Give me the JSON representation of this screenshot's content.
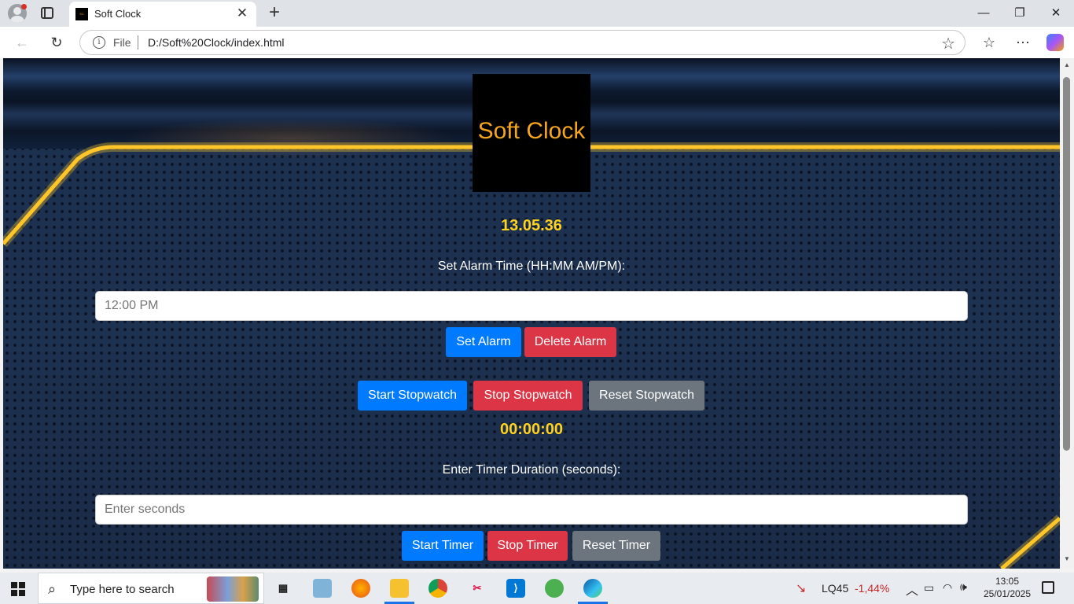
{
  "browser": {
    "tab_title": "Soft Clock",
    "tab_close": "✕",
    "new_tab": "+",
    "address_scheme": "File",
    "address_url": "D:/Soft%20Clock/index.html",
    "window_controls": {
      "minimize": "—",
      "restore": "❐",
      "close": "✕"
    }
  },
  "page": {
    "logo_text": "Soft Clock",
    "clock_time": "13.05.36",
    "alarm_label": "Set Alarm Time (HH:MM AM/PM):",
    "alarm_placeholder": "12:00 PM",
    "set_alarm": "Set Alarm",
    "delete_alarm": "Delete Alarm",
    "start_stopwatch": "Start Stopwatch",
    "stop_stopwatch": "Stop Stopwatch",
    "reset_stopwatch": "Reset Stopwatch",
    "stopwatch_time": "00:00:00",
    "timer_label": "Enter Timer Duration (seconds):",
    "timer_placeholder": "Enter seconds",
    "start_timer": "Start Timer",
    "stop_timer": "Stop Timer",
    "reset_timer": "Reset Timer",
    "colors": {
      "accent_gold": "#ffd21f",
      "logo_orange": "#f5a61c",
      "primary": "#007bff",
      "danger": "#dc3545",
      "secondary": "#6c757d"
    }
  },
  "taskbar": {
    "search_placeholder": "Type here to search",
    "stock_name": "LQ45",
    "stock_change": "-1,44%",
    "time": "13:05",
    "date": "25/01/2025"
  }
}
